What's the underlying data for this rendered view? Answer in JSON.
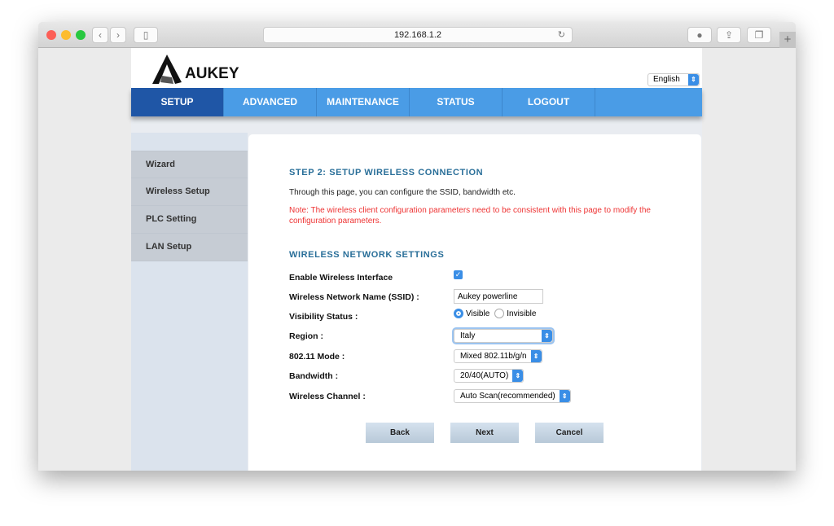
{
  "browser": {
    "url": "192.168.1.2"
  },
  "header": {
    "logo_text": "AUKEY",
    "language": "English"
  },
  "nav": [
    {
      "label": "SETUP"
    },
    {
      "label": "ADVANCED"
    },
    {
      "label": "MAINTENANCE"
    },
    {
      "label": "STATUS"
    },
    {
      "label": "LOGOUT"
    }
  ],
  "sidebar": [
    {
      "label": "Wizard"
    },
    {
      "label": "Wireless Setup"
    },
    {
      "label": "PLC Setting"
    },
    {
      "label": "LAN Setup"
    }
  ],
  "main": {
    "step_title": "STEP 2: SETUP WIRELESS CONNECTION",
    "intro": "Through this page, you can configure the SSID, bandwidth etc.",
    "note": "Note: The wireless client configuration parameters need to be consistent with this page to modify the configuration parameters.",
    "section_title": "WIRELESS NETWORK SETTINGS",
    "enable_label": "Enable Wireless Interface",
    "enable_checked": true,
    "ssid_label": "Wireless Network Name (SSID) :",
    "ssid_value": "Aukey powerline",
    "visibility_label": "Visibility Status :",
    "visible_label": "Visible",
    "invisible_label": "Invisible",
    "visibility_selected": "Visible",
    "region_label": "Region :",
    "region_value": "Italy",
    "mode_label": "802.11 Mode :",
    "mode_value": "Mixed 802.11b/g/n",
    "bandwidth_label": "Bandwidth :",
    "bandwidth_value": "20/40(AUTO)",
    "channel_label": "Wireless Channel :",
    "channel_value": "Auto Scan(recommended)",
    "back": "Back",
    "next": "Next",
    "cancel": "Cancel"
  }
}
